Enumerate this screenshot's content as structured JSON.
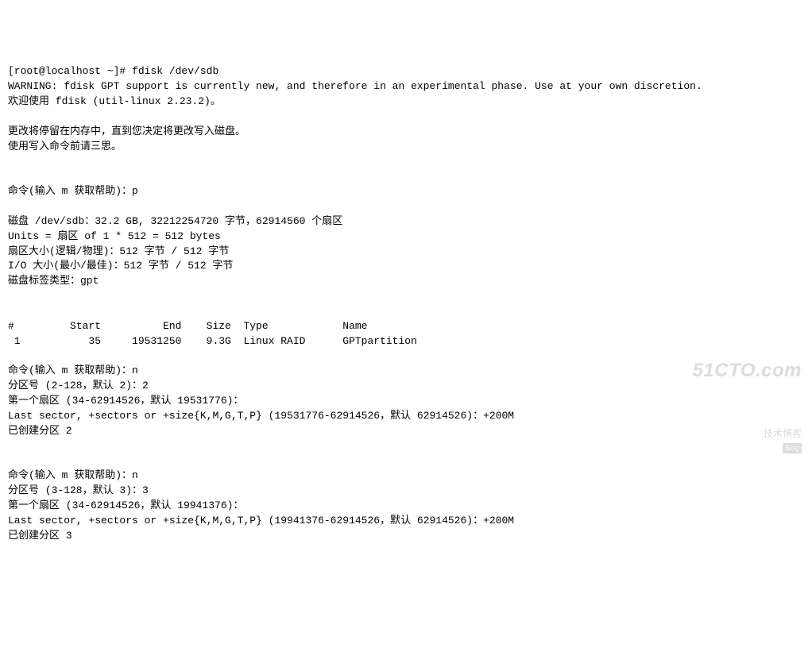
{
  "lines": [
    "[root@localhost ~]# fdisk /dev/sdb",
    "WARNING: fdisk GPT support is currently new, and therefore in an experimental phase. Use at your own discretion.",
    "欢迎使用 fdisk (util-linux 2.23.2)。",
    "",
    "更改将停留在内存中，直到您决定将更改写入磁盘。",
    "使用写入命令前请三思。",
    "",
    "",
    "命令(输入 m 获取帮助)：p",
    "",
    "磁盘 /dev/sdb：32.2 GB, 32212254720 字节，62914560 个扇区",
    "Units = 扇区 of 1 * 512 = 512 bytes",
    "扇区大小(逻辑/物理)：512 字节 / 512 字节",
    "I/O 大小(最小/最佳)：512 字节 / 512 字节",
    "磁盘标签类型：gpt",
    "",
    "",
    "#         Start          End    Size  Type            Name",
    " 1           35     19531250    9.3G  Linux RAID      GPTpartition",
    "",
    "命令(输入 m 获取帮助)：n",
    "分区号 (2-128，默认 2)：2",
    "第一个扇区 (34-62914526，默认 19531776)：",
    "Last sector, +sectors or +size{K,M,G,T,P} (19531776-62914526，默认 62914526)：+200M",
    "已创建分区 2",
    "",
    "",
    "命令(输入 m 获取帮助)：n",
    "分区号 (3-128，默认 3)：3",
    "第一个扇区 (34-62914526，默认 19941376)：",
    "Last sector, +sectors or +size{K,M,G,T,P} (19941376-62914526，默认 62914526)：+200M",
    "已创建分区 3"
  ],
  "watermark": {
    "main": "51CTO.com",
    "sub": "技术博客",
    "badge": "Blog"
  }
}
